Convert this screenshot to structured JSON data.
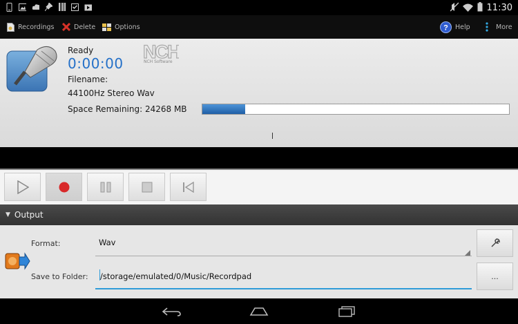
{
  "status_bar": {
    "time": "11:30",
    "left_icons": [
      "phone-icon",
      "image-icon",
      "cloud-upload-icon",
      "pin-icon",
      "barcode-icon",
      "clipboard-check-icon",
      "play-store-icon"
    ],
    "right_icons": [
      "mute-icon",
      "wifi-icon",
      "battery-icon"
    ]
  },
  "action_bar": {
    "recordings_label": "Recordings",
    "delete_label": "Delete",
    "options_label": "Options",
    "help_label": "Help",
    "more_label": "More"
  },
  "info": {
    "status": "Ready",
    "timer": "0:00:00",
    "logo_text": "NCH",
    "logo_subtext": "NCH Software",
    "filename_label": "Filename:",
    "filename_value": "44100Hz Stereo Wav",
    "space_remaining": "Space Remaining: 24268 MB",
    "space_used_fraction": 0.14
  },
  "transport": {
    "buttons": [
      "play",
      "record",
      "pause",
      "stop",
      "rewind"
    ],
    "active": "record"
  },
  "output": {
    "header": "Output",
    "format_label": "Format:",
    "format_value": "Wav",
    "folder_label": "Save to Folder:",
    "folder_value": "/storage/emulated/0/Music/Recordpad",
    "browse_label": "..."
  },
  "nav_bar": {
    "icons": [
      "back-icon",
      "home-icon",
      "recent-apps-icon"
    ]
  },
  "colors": {
    "timer": "#2470c8",
    "progress": "#2f74c0",
    "accent_line": "#2e9bd8"
  }
}
